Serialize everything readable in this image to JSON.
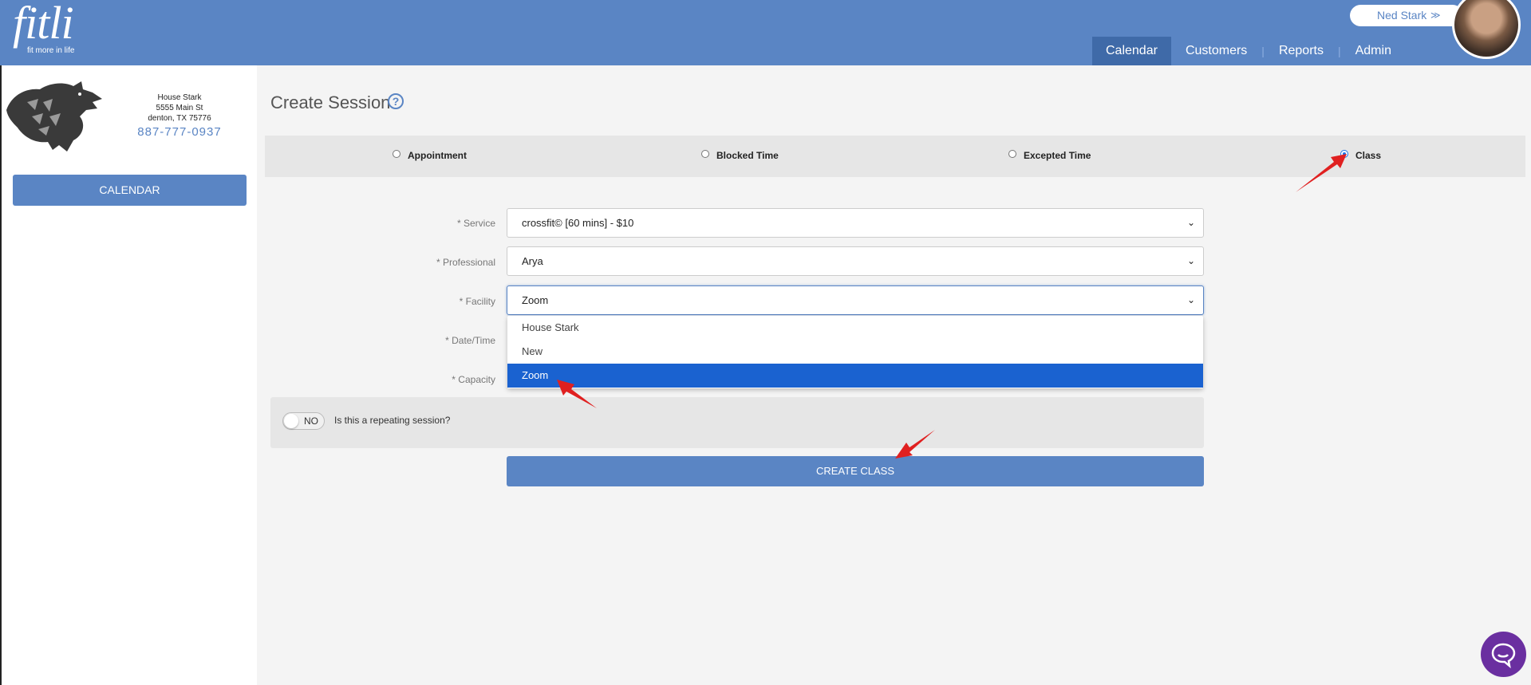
{
  "header": {
    "logo_text": "fitli",
    "logo_tagline": "fit more in life",
    "nav": [
      "Calendar",
      "Customers",
      "Reports",
      "Admin"
    ],
    "active_nav": "Calendar",
    "user_name": "Ned Stark",
    "user_chevron": "double-chevron-down-icon",
    "brand_color": "#5a85c4"
  },
  "sidebar": {
    "business_name": "House Stark",
    "address1": "5555 Main St",
    "address2": "denton, TX 75776",
    "phone": "887-777-0937",
    "calendar_button": "CALENDAR"
  },
  "page": {
    "title": "Create Session",
    "help_icon": "?"
  },
  "session_types": {
    "options": [
      "Appointment",
      "Blocked Time",
      "Excepted Time",
      "Class"
    ],
    "selected": "Class"
  },
  "form": {
    "service_label": "* Service",
    "service_value": "crossfit© [60 mins] - $10",
    "professional_label": "* Professional",
    "professional_value": "Arya",
    "facility_label": "* Facility",
    "facility_value": "Zoom",
    "facility_options": [
      "House Stark",
      "New",
      "Zoom"
    ],
    "facility_highlighted": "Zoom",
    "datetime_label": "* Date/Time",
    "capacity_label": "* Capacity",
    "repeat_toggle": "NO",
    "repeat_question": "Is this a repeating session?",
    "submit_label": "CREATE CLASS"
  },
  "chat_icon": "chat-bubble-icon",
  "annotation_color": "#e02020"
}
